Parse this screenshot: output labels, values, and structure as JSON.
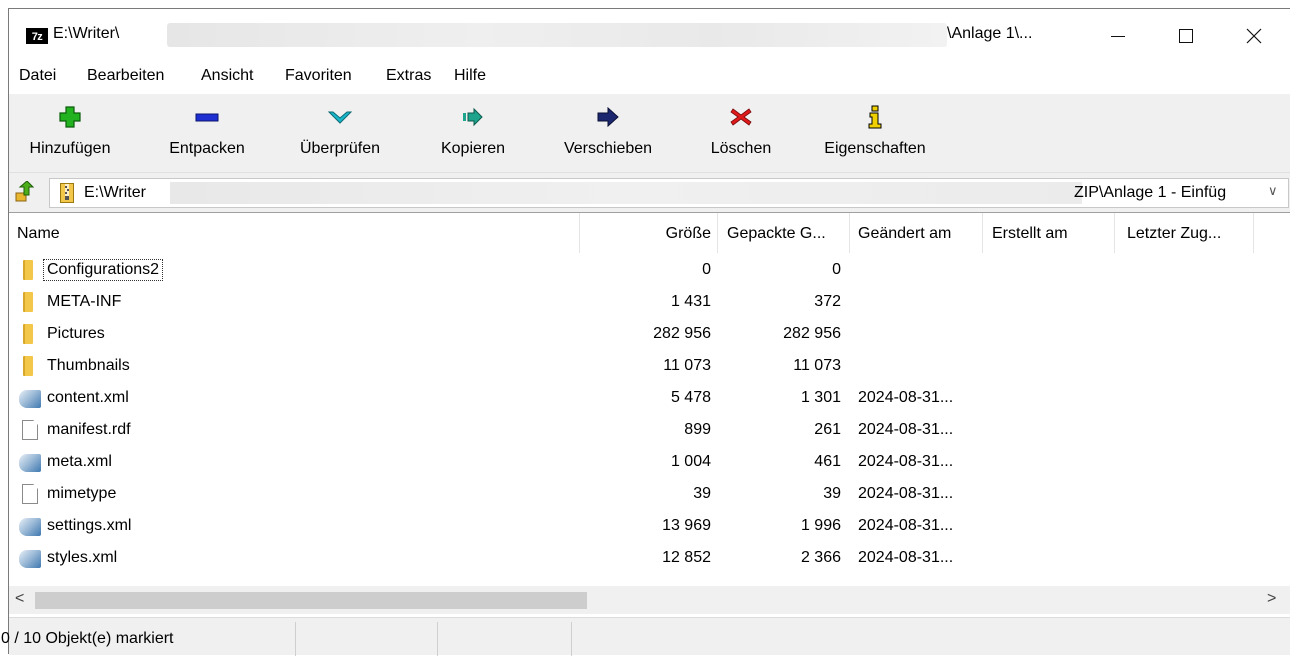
{
  "window": {
    "title_left": "E:\\Writer\\",
    "title_right": "\\Anlage 1\\...",
    "app_icon_text": "7z"
  },
  "menu": [
    "Datei",
    "Bearbeiten",
    "Ansicht",
    "Favoriten",
    "Extras",
    "Hilfe"
  ],
  "toolbar": {
    "add": "Hinzufügen",
    "extract": "Entpacken",
    "test": "Überprüfen",
    "copy": "Kopieren",
    "move": "Verschieben",
    "delete": "Löschen",
    "info": "Eigenschaften"
  },
  "address": {
    "left": "E:\\Writer",
    "right": "ZIP\\Anlage 1 - Einfüg",
    "dropdown": "∨"
  },
  "columns": {
    "name": "Name",
    "size": "Größe",
    "packed": "Gepackte G...",
    "modified": "Geändert am",
    "created": "Erstellt am",
    "accessed": "Letzter Zug..."
  },
  "files": [
    {
      "type": "folder",
      "name": "Configurations2",
      "size": "0",
      "packed": "0",
      "modified": ""
    },
    {
      "type": "folder",
      "name": "META-INF",
      "size": "1 431",
      "packed": "372",
      "modified": ""
    },
    {
      "type": "folder",
      "name": "Pictures",
      "size": "282 956",
      "packed": "282 956",
      "modified": ""
    },
    {
      "type": "folder",
      "name": "Thumbnails",
      "size": "11 073",
      "packed": "11 073",
      "modified": ""
    },
    {
      "type": "xml",
      "name": "content.xml",
      "size": "5 478",
      "packed": "1 301",
      "modified": "2024-08-31..."
    },
    {
      "type": "file",
      "name": "manifest.rdf",
      "size": "899",
      "packed": "261",
      "modified": "2024-08-31..."
    },
    {
      "type": "xml",
      "name": "meta.xml",
      "size": "1 004",
      "packed": "461",
      "modified": "2024-08-31..."
    },
    {
      "type": "file",
      "name": "mimetype",
      "size": "39",
      "packed": "39",
      "modified": "2024-08-31..."
    },
    {
      "type": "xml",
      "name": "settings.xml",
      "size": "13 969",
      "packed": "1 996",
      "modified": "2024-08-31..."
    },
    {
      "type": "xml",
      "name": "styles.xml",
      "size": "12 852",
      "packed": "2 366",
      "modified": "2024-08-31..."
    }
  ],
  "scroll": {
    "left_arrow": "<",
    "right_arrow": ">"
  },
  "status": {
    "selection": "0 / 10 Objekt(e) markiert"
  },
  "colors": {
    "toolbar_bg": "#f0f0f0",
    "add_green": "#22b21f",
    "extract_blue": "#1d2fd0",
    "test_cyan": "#19b6c9",
    "copy_teal": "#1ea38c",
    "move_navy": "#1b2870",
    "delete_red": "#e01a1a",
    "info_yellow": "#f0d000"
  }
}
